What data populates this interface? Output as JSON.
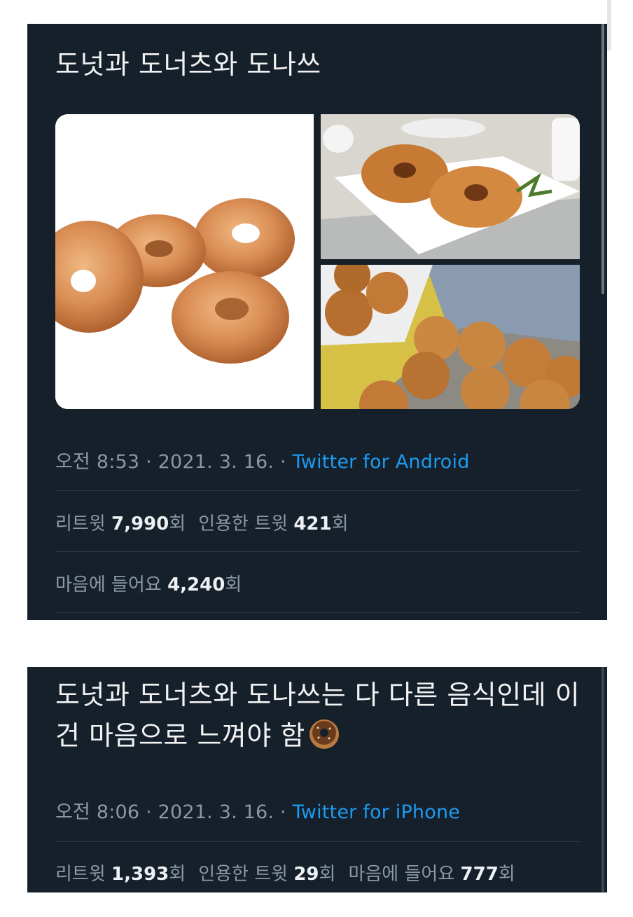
{
  "tweet1": {
    "text": "도넛과 도너츠와 도나쓰",
    "time": "오전 8:53 · 2021. 3. 16. · ",
    "source": "Twitter for Android",
    "retweet_label": "리트윗 ",
    "retweet_count": "7,990",
    "retweet_unit": "회",
    "quote_label": "인용한 트윗 ",
    "quote_count": "421",
    "quote_unit": "회",
    "like_label": "마음에 들어요 ",
    "like_count": "4,240",
    "like_unit": "회",
    "media": [
      "glazed-donuts-photo",
      "cake-donuts-plate-photo",
      "donut-holes-tray-photo"
    ]
  },
  "tweet2": {
    "text": "도넛과 도너츠와 도나쓰는 다 다른 음식인데 이건 마음으로 느껴야 함",
    "emoji": "doughnut-emoji",
    "time": "오전 8:06 · 2021. 3. 16. · ",
    "source": "Twitter for iPhone",
    "retweet_label": "리트윗 ",
    "retweet_count": "1,393",
    "retweet_unit": "회",
    "quote_label": "인용한 트윗 ",
    "quote_count": "29",
    "quote_unit": "회",
    "like_label": "마음에 들어요 ",
    "like_count": "777",
    "like_unit": "회"
  },
  "colors": {
    "background": "#15202b",
    "link": "#1d9bf0",
    "muted": "#8b98a5"
  }
}
